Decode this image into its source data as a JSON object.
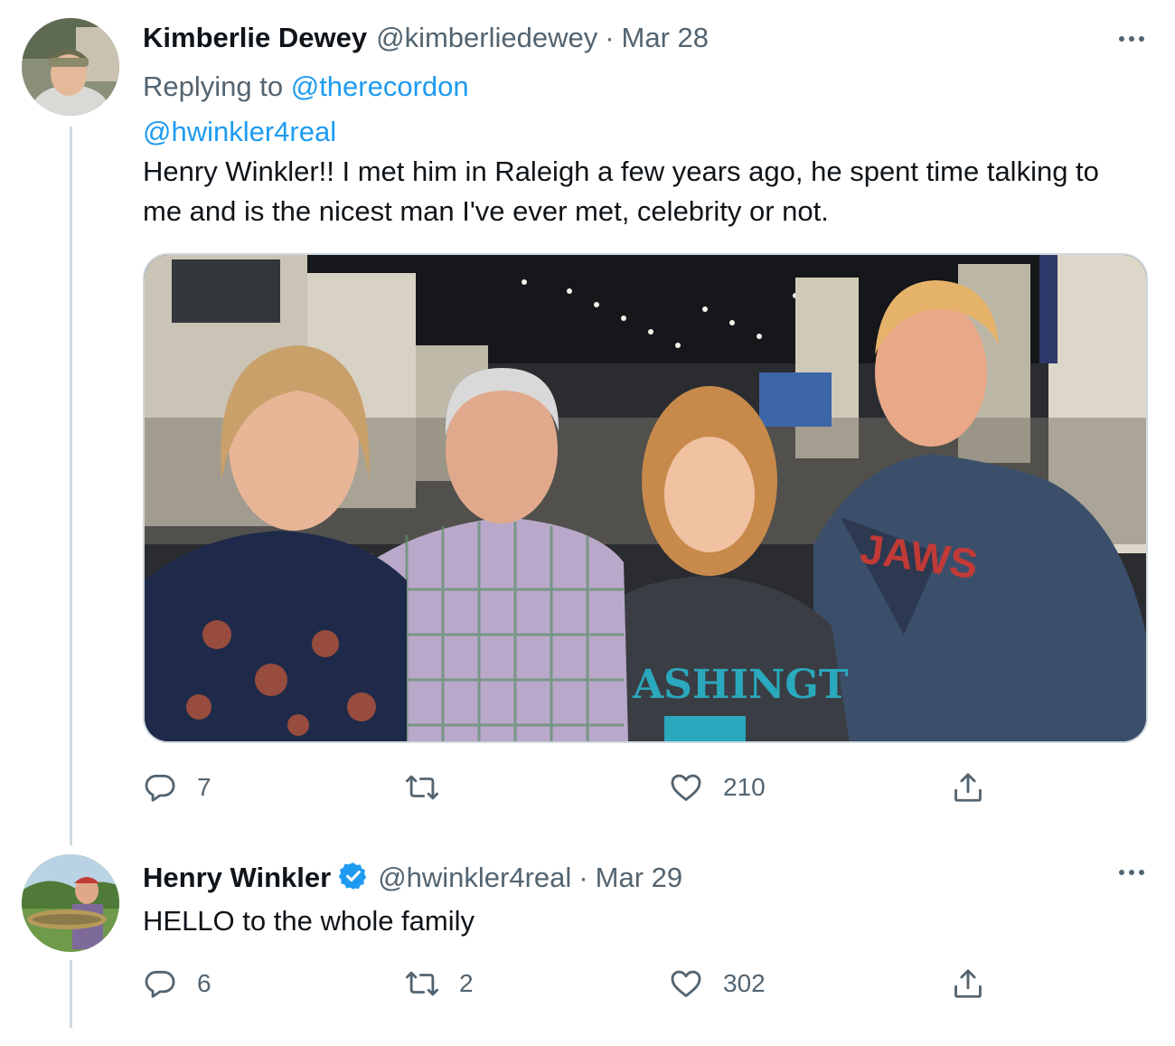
{
  "tweets": [
    {
      "name": "Kimberlie Dewey",
      "handle": "@kimberliedewey",
      "separator": "·",
      "date": "Mar 28",
      "replying_prefix": "Replying to",
      "replying_to": "@therecordon",
      "mention": "@hwinkler4real",
      "text": "Henry Winkler!! I met him in Raleigh a few years ago, he spent time talking to me and is the nicest man I've ever met, celebrity or not.",
      "verified": false,
      "has_media": true,
      "media_description": "photo of four people smiling at a convention hall",
      "stats": {
        "replies": "7",
        "retweets": "",
        "likes": "210"
      }
    },
    {
      "name": "Henry Winkler",
      "handle": "@hwinkler4real",
      "separator": "·",
      "date": "Mar 29",
      "text": "HELLO to the whole family",
      "verified": true,
      "has_media": false,
      "stats": {
        "replies": "6",
        "retweets": "2",
        "likes": "302"
      }
    }
  ],
  "icons": {
    "reply": "speech-bubble-icon",
    "retweet": "retweet-arrows-icon",
    "like": "heart-outline-icon",
    "share": "upload-share-icon",
    "more": "ellipsis-icon",
    "verified": "verified-badge-icon"
  },
  "colors": {
    "link": "#1d9bf0",
    "secondary_text": "#536471",
    "primary_text": "#0f1419",
    "thread_line": "#cfd9de",
    "verified": "#1d9bf0"
  }
}
